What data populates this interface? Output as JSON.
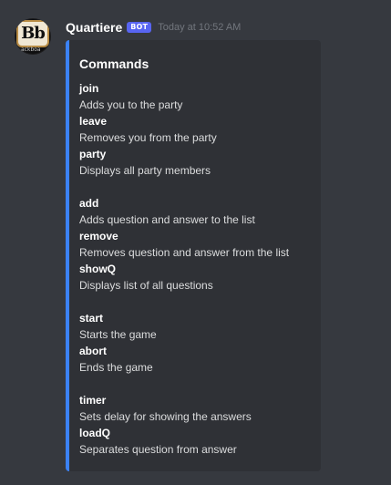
{
  "message": {
    "author": {
      "name": "Quartiere",
      "tag": "BOT",
      "timestamp": "Today at 10:52 AM",
      "avatar": {
        "initials": "Bb",
        "caption": "ackboa"
      }
    },
    "embed": {
      "accent_color": "#3b82f6",
      "title": "Commands",
      "groups": [
        {
          "commands": [
            {
              "name": "join",
              "description": "Adds you to the party"
            },
            {
              "name": "leave",
              "description": "Removes you from the party"
            },
            {
              "name": "party",
              "description": "Displays all party members"
            }
          ]
        },
        {
          "commands": [
            {
              "name": "add",
              "description": "Adds question and answer to the list"
            },
            {
              "name": "remove",
              "description": "Removes question and answer from the list"
            },
            {
              "name": "showQ",
              "description": "Displays list of all questions"
            }
          ]
        },
        {
          "commands": [
            {
              "name": "start",
              "description": "Starts the game"
            },
            {
              "name": "abort",
              "description": "Ends the game"
            }
          ]
        },
        {
          "commands": [
            {
              "name": "timer",
              "description": "Sets delay for showing the answers"
            },
            {
              "name": "loadQ",
              "description": "Separates question from answer"
            }
          ]
        }
      ]
    }
  }
}
